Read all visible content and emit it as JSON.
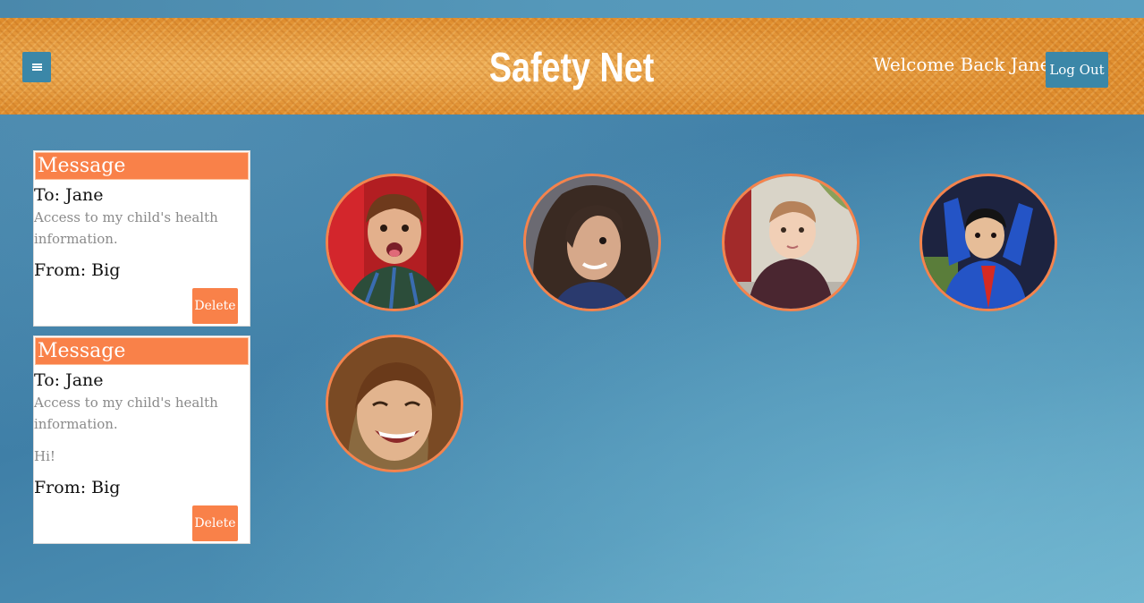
{
  "header": {
    "title": "Safety Net",
    "welcome": "Welcome Back Jane",
    "logout_label": "Log Out",
    "menu_icon": "hamburger-icon"
  },
  "messages": [
    {
      "heading": "Message",
      "to": "To: Jane",
      "body": "Access to my child's health information.",
      "extra": "",
      "from": "From: Big",
      "delete_label": "Delete"
    },
    {
      "heading": "Message",
      "to": "To: Jane",
      "body": "Access to my child's health information.",
      "extra": "Hi!",
      "from": "From: Big",
      "delete_label": "Delete"
    }
  ],
  "children": [
    {
      "photo": "child-photo-1"
    },
    {
      "photo": "child-photo-2"
    },
    {
      "photo": "child-photo-3"
    },
    {
      "photo": "child-photo-4"
    },
    {
      "photo": "child-photo-5"
    }
  ],
  "colors": {
    "accent_orange": "#f98149",
    "button_blue": "#3b87a8",
    "header_orange": "#e49a3d",
    "background_blue": "#4585aa"
  }
}
